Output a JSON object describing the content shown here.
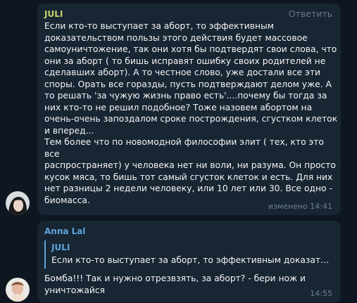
{
  "colors": {
    "background": "#0e1621",
    "bubble": "#182533",
    "juli_name": "#c7d36d",
    "anna_name": "#5ea5dc",
    "muted": "#6d7f8f"
  },
  "messages": [
    {
      "author": "JULI",
      "reply_label": "Ответить",
      "text": "Если кто-то выступает за аборт, то эффективным\nдоказательством пользы этого действия будет массовое\nсамоуничтожение, так они хотя бы подтвердят свои слова, что\nони за аборт ( то бишь исправят ошибку своих  родителей не\nсделавших аборт). А то честное слово, уже достали все эти\nспоры. Орать все горазды,  пусть подтверждают делом уже.  А\nто решать 'за чужую жизнь право есть'....почему бы тогда за\nних кто-то не решил подобное? Тоже назовем абортом на\nочень-очень запоздалом сроке построждения, сгустком клеток\nи вперед...\nТем более что по новомодной философии элит ( тех, кто это все\nраспространяет) у человека нет ни воли,  ни разума. Он просто\nкусок мяса,  то бишь тот самый сгусток клеток и есть. Для них\nнет разницы 2 недели человеку, или 10 лет или 30. Все одно -\nбиомасса.",
      "status": "изменено 14:41",
      "avatar_icon": "juli-avatar-icon"
    },
    {
      "author": "Anna Lal",
      "quote": {
        "author": "JULI",
        "text": "Если кто-то выступает за аборт, то эффективным доказательс..."
      },
      "text": "Бомба!!! Так и нужно отрезвзять, за аборт? - бери нож и\nуничтожайся",
      "time": "14:55",
      "avatar_icon": "anna-avatar-icon"
    }
  ]
}
